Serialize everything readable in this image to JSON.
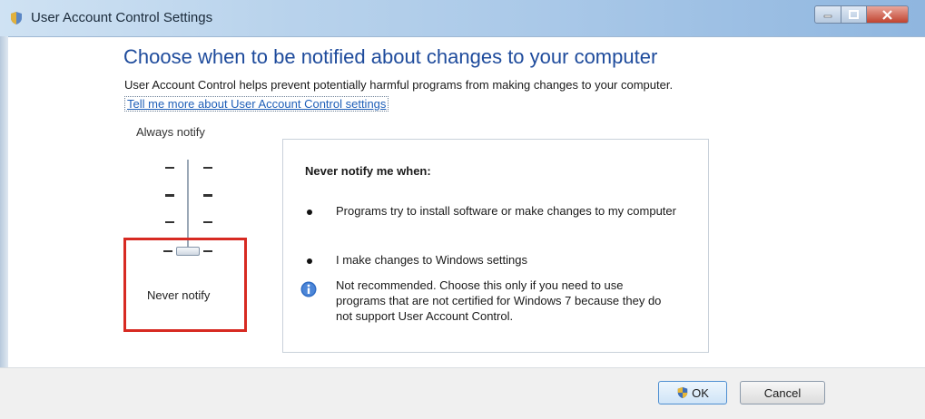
{
  "window": {
    "title": "User Account Control Settings",
    "caption_min": "–",
    "caption_max": "□",
    "caption_close": "✕"
  },
  "main": {
    "heading": "Choose when to be notified about changes to your computer",
    "description": "User Account Control helps prevent potentially harmful programs from making changes to your computer.",
    "link": "Tell me more about User Account Control settings"
  },
  "slider": {
    "top_label": "Always notify",
    "bottom_label": "Never notify",
    "level": 0,
    "levels": 4
  },
  "panel": {
    "title": "Never notify me when:",
    "bullets": [
      "Programs try to install software or make changes to my computer",
      "I make changes to Windows settings"
    ],
    "note": "Not recommended. Choose this only if you need to use programs that are not certified for Windows 7 because they do not support User Account Control."
  },
  "footer": {
    "ok_label": "OK",
    "cancel_label": "Cancel"
  },
  "colors": {
    "heading": "#1e4b9c",
    "link": "#1f5fb8",
    "highlight": "#d72a22"
  }
}
